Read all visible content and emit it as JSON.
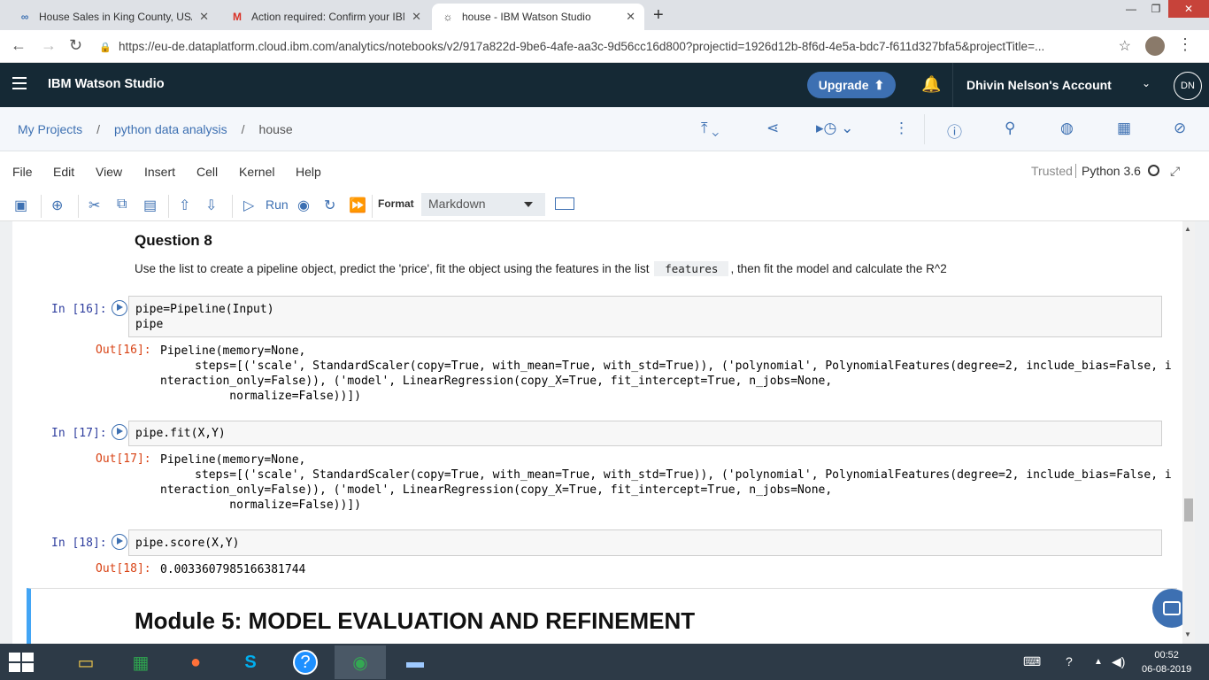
{
  "browser": {
    "tabs": [
      {
        "title": "House Sales in King County, USA",
        "icon": "cognitive-class-icon"
      },
      {
        "title": "Action required: Confirm your IBM",
        "icon": "gmail-icon"
      },
      {
        "title": "house - IBM Watson Studio",
        "icon": "watson-icon"
      }
    ],
    "url": "https://eu-de.dataplatform.cloud.ibm.com/analytics/notebooks/v2/917a822d-9be6-4afe-aa3c-9d56cc16d800?projectid=1926d12b-8f6d-4e5a-bdc7-f611d327bfa5&projectTitle=..."
  },
  "header": {
    "brand": "IBM Watson Studio",
    "upgrade_label": "Upgrade",
    "account": "Dhivin Nelson's Account",
    "avatar_initials": "DN"
  },
  "breadcrumb": {
    "items": [
      "My Projects",
      "python data analysis"
    ],
    "current": "house"
  },
  "menubar": {
    "items": [
      "File",
      "Edit",
      "View",
      "Insert",
      "Cell",
      "Kernel",
      "Help"
    ],
    "trusted": "Trusted",
    "kernel": "Python 3.6"
  },
  "toolbar": {
    "run_label": "Run",
    "format_label": "Format",
    "format_value": "Markdown"
  },
  "notebook": {
    "question_heading": "Question 8",
    "question_text_before": "Use the list to create a pipeline object, predict the 'price', fit the object using the features in the list",
    "question_code": "features",
    "question_text_after": ", then fit the model and calculate the R^2",
    "cells": [
      {
        "in_prompt": "In [16]:",
        "code": "pipe=Pipeline(Input)\npipe",
        "out_prompt": "Out[16]:",
        "output": "Pipeline(memory=None,\n     steps=[('scale', StandardScaler(copy=True, with_mean=True, with_std=True)), ('polynomial', PolynomialFeatures(degree=2, include_bias=False, i\nnteraction_only=False)), ('model', LinearRegression(copy_X=True, fit_intercept=True, n_jobs=None,\n          normalize=False))])"
      },
      {
        "in_prompt": "In [17]:",
        "code": "pipe.fit(X,Y)",
        "out_prompt": "Out[17]:",
        "output": "Pipeline(memory=None,\n     steps=[('scale', StandardScaler(copy=True, with_mean=True, with_std=True)), ('polynomial', PolynomialFeatures(degree=2, include_bias=False, i\nnteraction_only=False)), ('model', LinearRegression(copy_X=True, fit_intercept=True, n_jobs=None,\n          normalize=False))])"
      },
      {
        "in_prompt": "In [18]:",
        "code": "pipe.score(X,Y)",
        "out_prompt": "Out[18]:",
        "output": "0.0033607985166381744"
      }
    ],
    "module_heading": "Module 5: MODEL EVALUATION AND REFINEMENT"
  },
  "taskbar": {
    "apps": [
      "file-explorer-icon",
      "store-icon",
      "firefox-icon",
      "skype-icon",
      "help-icon",
      "chrome-icon",
      "photos-icon"
    ],
    "time": "00:52",
    "date": "06-08-2019"
  }
}
